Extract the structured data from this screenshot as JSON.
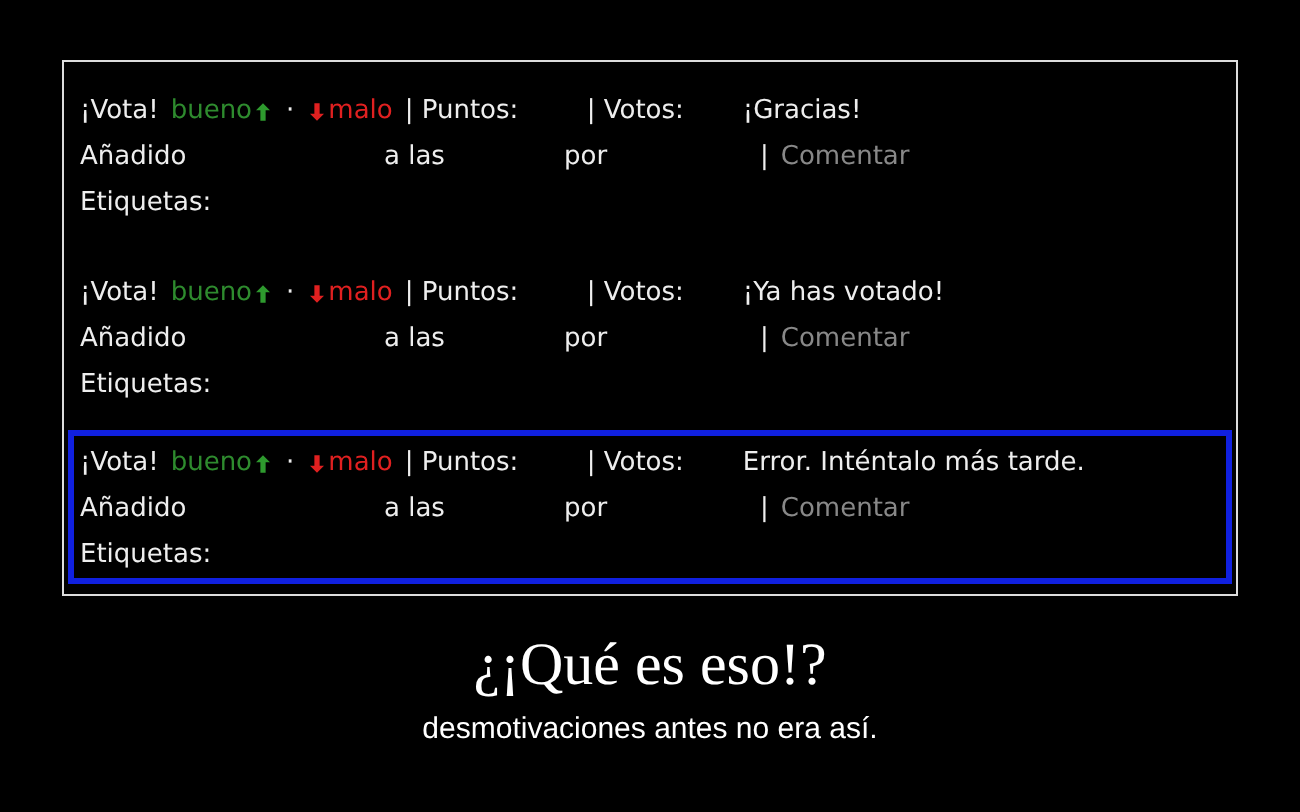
{
  "entries": [
    {
      "highlighted": false,
      "vote_label": "¡Vota!",
      "up_label": "bueno",
      "separator": "·",
      "down_label": "malo",
      "points_label": "| Puntos:",
      "votes_label": "| Votos:",
      "message": "¡Gracias!",
      "added_label": "Añadido",
      "time_label": "a las",
      "by_label": "por",
      "comment_separator": "|",
      "comment_link": "Comentar",
      "tags_label": "Etiquetas:"
    },
    {
      "highlighted": false,
      "vote_label": "¡Vota!",
      "up_label": "bueno",
      "separator": "·",
      "down_label": "malo",
      "points_label": "| Puntos:",
      "votes_label": "| Votos:",
      "message": "¡Ya has votado!",
      "added_label": "Añadido",
      "time_label": "a las",
      "by_label": "por",
      "comment_separator": "|",
      "comment_link": "Comentar",
      "tags_label": "Etiquetas:"
    },
    {
      "highlighted": true,
      "vote_label": "¡Vota!",
      "up_label": "bueno",
      "separator": "·",
      "down_label": "malo",
      "points_label": "| Puntos:",
      "votes_label": "| Votos:",
      "message": "Error. Inténtalo más tarde.",
      "added_label": "Añadido",
      "time_label": "a las",
      "by_label": "por",
      "comment_separator": "|",
      "comment_link": "Comentar",
      "tags_label": "Etiquetas:"
    }
  ],
  "caption": {
    "title": "¿¡Qué es eso!?",
    "subtitle": "desmotivaciones antes no era así."
  }
}
